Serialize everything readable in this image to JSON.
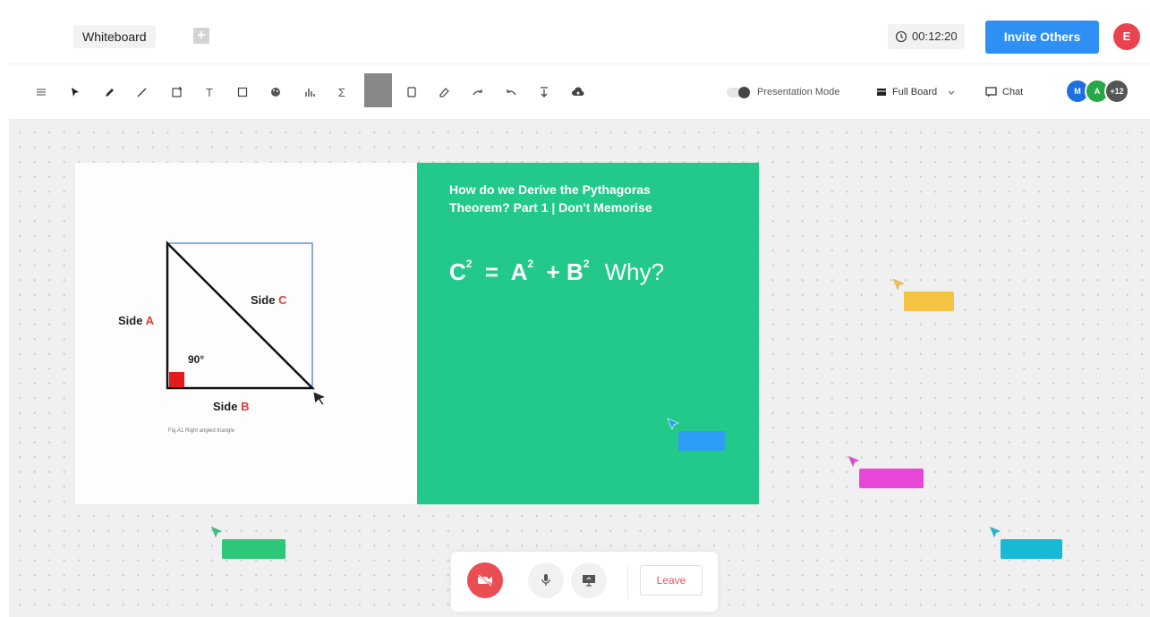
{
  "header": {
    "tab_title": "Whiteboard",
    "add_tab_label": "+",
    "timer": "00:12:20",
    "invite_label": "Invite Others",
    "user_initial": "E"
  },
  "toolbar": {
    "tools": [
      "menu-icon",
      "select-icon",
      "pen-icon",
      "line-icon",
      "sticky-note-icon",
      "text-icon",
      "shape-icon",
      "color-picker-icon",
      "chart-icon",
      "formula-icon",
      "color-swatch",
      "rectangle-icon",
      "eraser-icon",
      "redo-icon",
      "undo-icon",
      "download-icon",
      "cloud-upload-icon"
    ],
    "text_tool_label": "T",
    "formula_tool_label": "Σ",
    "presentation_mode_label": "Presentation Mode",
    "presentation_mode_on": false,
    "full_board_label": "Full Board",
    "chat_label": "Chat",
    "avatars": [
      {
        "label": "M",
        "color": "#1e6fe0"
      },
      {
        "label": "A",
        "color": "#28a745"
      },
      {
        "label": "+12",
        "color": "#555555"
      }
    ]
  },
  "board": {
    "diagram": {
      "side_a_prefix": "Side ",
      "side_a_letter": "A",
      "side_b_prefix": "Side ",
      "side_b_letter": "B",
      "side_c_prefix": "Side ",
      "side_c_letter": "C",
      "angle_label": "90°",
      "caption": "Fig.A1 Right angled triangle"
    },
    "slide": {
      "title": "How do we Derive the Pythagoras Theorem? Part 1 | Don't Memorise",
      "formula_c": "C",
      "formula_a": "A",
      "formula_b": "B",
      "exponent": "2",
      "equals": "=",
      "plus": "+",
      "why": "Why?"
    },
    "collaborator_cursors": [
      {
        "color": "#f5c342"
      },
      {
        "color": "#2e9df5"
      },
      {
        "color": "#e846d8"
      },
      {
        "color": "#2ec77a"
      },
      {
        "color": "#18b9d4"
      }
    ]
  },
  "controls": {
    "leave_label": "Leave"
  },
  "colors": {
    "accent": "#2e8ff5",
    "slide_green": "#23c98b",
    "danger": "#ea4d52"
  }
}
